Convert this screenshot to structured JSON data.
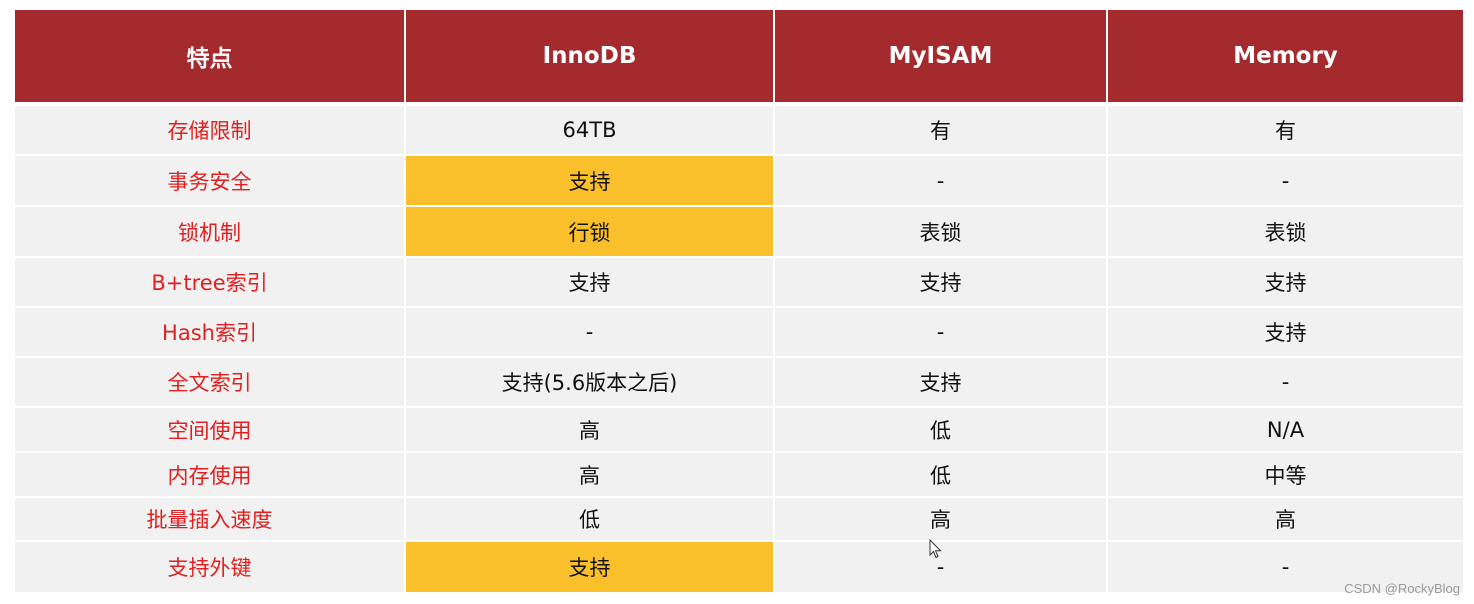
{
  "table": {
    "headers": [
      "特点",
      "InnoDB",
      "MyISAM",
      "Memory"
    ],
    "rows": [
      {
        "feature": "存储限制",
        "innodb": "64TB",
        "myisam": "有",
        "memory": "有",
        "innodb_highlight": false
      },
      {
        "feature": "事务安全",
        "innodb": "支持",
        "myisam": "-",
        "memory": "-",
        "innodb_highlight": true
      },
      {
        "feature": "锁机制",
        "innodb": "行锁",
        "myisam": "表锁",
        "memory": "表锁",
        "innodb_highlight": true
      },
      {
        "feature": "B+tree索引",
        "innodb": "支持",
        "myisam": "支持",
        "memory": "支持",
        "innodb_highlight": false
      },
      {
        "feature": "Hash索引",
        "innodb": "-",
        "myisam": "-",
        "memory": "支持",
        "innodb_highlight": false
      },
      {
        "feature": "全文索引",
        "innodb": "支持(5.6版本之后)",
        "myisam": "支持",
        "memory": "-",
        "innodb_highlight": false
      },
      {
        "feature": "空间使用",
        "innodb": "高",
        "myisam": "低",
        "memory": "N/A",
        "innodb_highlight": false
      },
      {
        "feature": "内存使用",
        "innodb": "高",
        "myisam": "低",
        "memory": "中等",
        "innodb_highlight": false
      },
      {
        "feature": "批量插入速度",
        "innodb": "低",
        "myisam": "高",
        "memory": "高",
        "innodb_highlight": false
      },
      {
        "feature": "支持外键",
        "innodb": "支持",
        "myisam": "-",
        "memory": "-",
        "innodb_highlight": true
      }
    ]
  },
  "colors": {
    "header_bg": "#a52a2d",
    "highlight": "#f9c02c",
    "feature_text": "#e02020",
    "cell_bg": "#f1f1f1"
  },
  "watermark": "CSDN @RockyBlog"
}
